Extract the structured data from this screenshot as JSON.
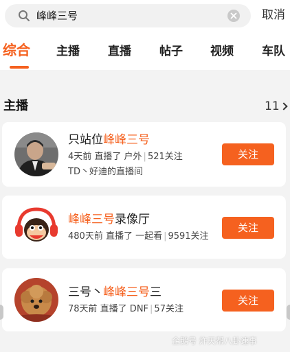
{
  "search": {
    "query": "峰峰三号",
    "cancel_label": "取消"
  },
  "tabs": [
    {
      "label": "综合"
    },
    {
      "label": "主播"
    },
    {
      "label": "直播"
    },
    {
      "label": "帖子"
    },
    {
      "label": "视频"
    },
    {
      "label": "车队"
    }
  ],
  "section": {
    "title": "主播",
    "count": "11"
  },
  "anchors": [
    {
      "name_prefix": "只站位",
      "name_highlight": "峰峰三号",
      "name_suffix": "",
      "time": "4天前 直播了 户外",
      "followers": "521关注",
      "description": "TD丶好迪的直播间",
      "follow_label": "关注"
    },
    {
      "name_prefix": "",
      "name_highlight": "峰峰三号",
      "name_suffix": "录像厅",
      "time": "480天前 直播了 一起看",
      "followers": "9591关注",
      "description": "",
      "follow_label": "关注"
    },
    {
      "name_prefix": "三号丶",
      "name_highlight": "峰峰三号",
      "name_suffix": "三",
      "time": "78天前 直播了 DNF",
      "followers": "57关注",
      "description": "",
      "follow_label": "关注"
    }
  ],
  "watermark": "企鹅号 炸天帮八卦速事",
  "colors": {
    "accent": "#f5611f",
    "background": "#f3f3f3"
  },
  "icons": [
    "search-icon",
    "clear-icon",
    "chevron-right-icon"
  ]
}
